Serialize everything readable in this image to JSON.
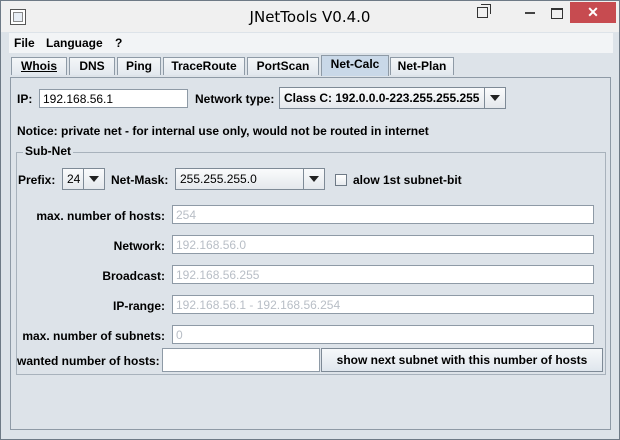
{
  "window": {
    "title": "JNetTools V0.4.0"
  },
  "menu": [
    "File",
    "Language",
    "?"
  ],
  "tabs": [
    {
      "label": "Whois",
      "active": false
    },
    {
      "label": "DNS",
      "active": false
    },
    {
      "label": "Ping",
      "active": false
    },
    {
      "label": "TraceRoute",
      "active": false
    },
    {
      "label": "PortScan",
      "active": false
    },
    {
      "label": "Net-Calc",
      "active": true
    },
    {
      "label": "Net-Plan",
      "active": false
    }
  ],
  "netcalc": {
    "ip_label": "IP:",
    "ip_value": "192.168.56.1",
    "network_type_label": "Network type:",
    "network_type_value": "Class C: 192.0.0.0-223.255.255.255",
    "notice": "Notice:  private net - for internal use only, would not be routed in internet",
    "subnet_legend": "Sub-Net",
    "prefix_label": "Prefix:",
    "prefix_value": "24",
    "netmask_label": "Net-Mask:",
    "netmask_value": "255.255.255.0",
    "allow_label": "alow 1st subnet-bit",
    "allow_checked": false,
    "max_hosts_label": "max. number of hosts:",
    "max_hosts_value": "254",
    "network_label": "Network:",
    "network_value": "192.168.56.0",
    "broadcast_label": "Broadcast:",
    "broadcast_value": "192.168.56.255",
    "iprange_label": "IP-range:",
    "iprange_value": "192.168.56.1 - 192.168.56.254",
    "max_subnets_label": "max. number of subnets:",
    "max_subnets_value": "0",
    "wanted_hosts_label": "wanted number of hosts:",
    "wanted_hosts_value": "",
    "show_next_button": "show next subnet with this number of hosts"
  },
  "icons": {
    "app": "app-window-icon",
    "restore": "restore-window-icon",
    "minimize": "minimize-icon",
    "maximize": "maximize-icon",
    "close": "close-icon"
  },
  "colors": {
    "close_button": "#c74b50",
    "active_tab": "#c9d8e8",
    "panel_bg": "#dde3e9",
    "readonly_text": "#b8bec6"
  }
}
